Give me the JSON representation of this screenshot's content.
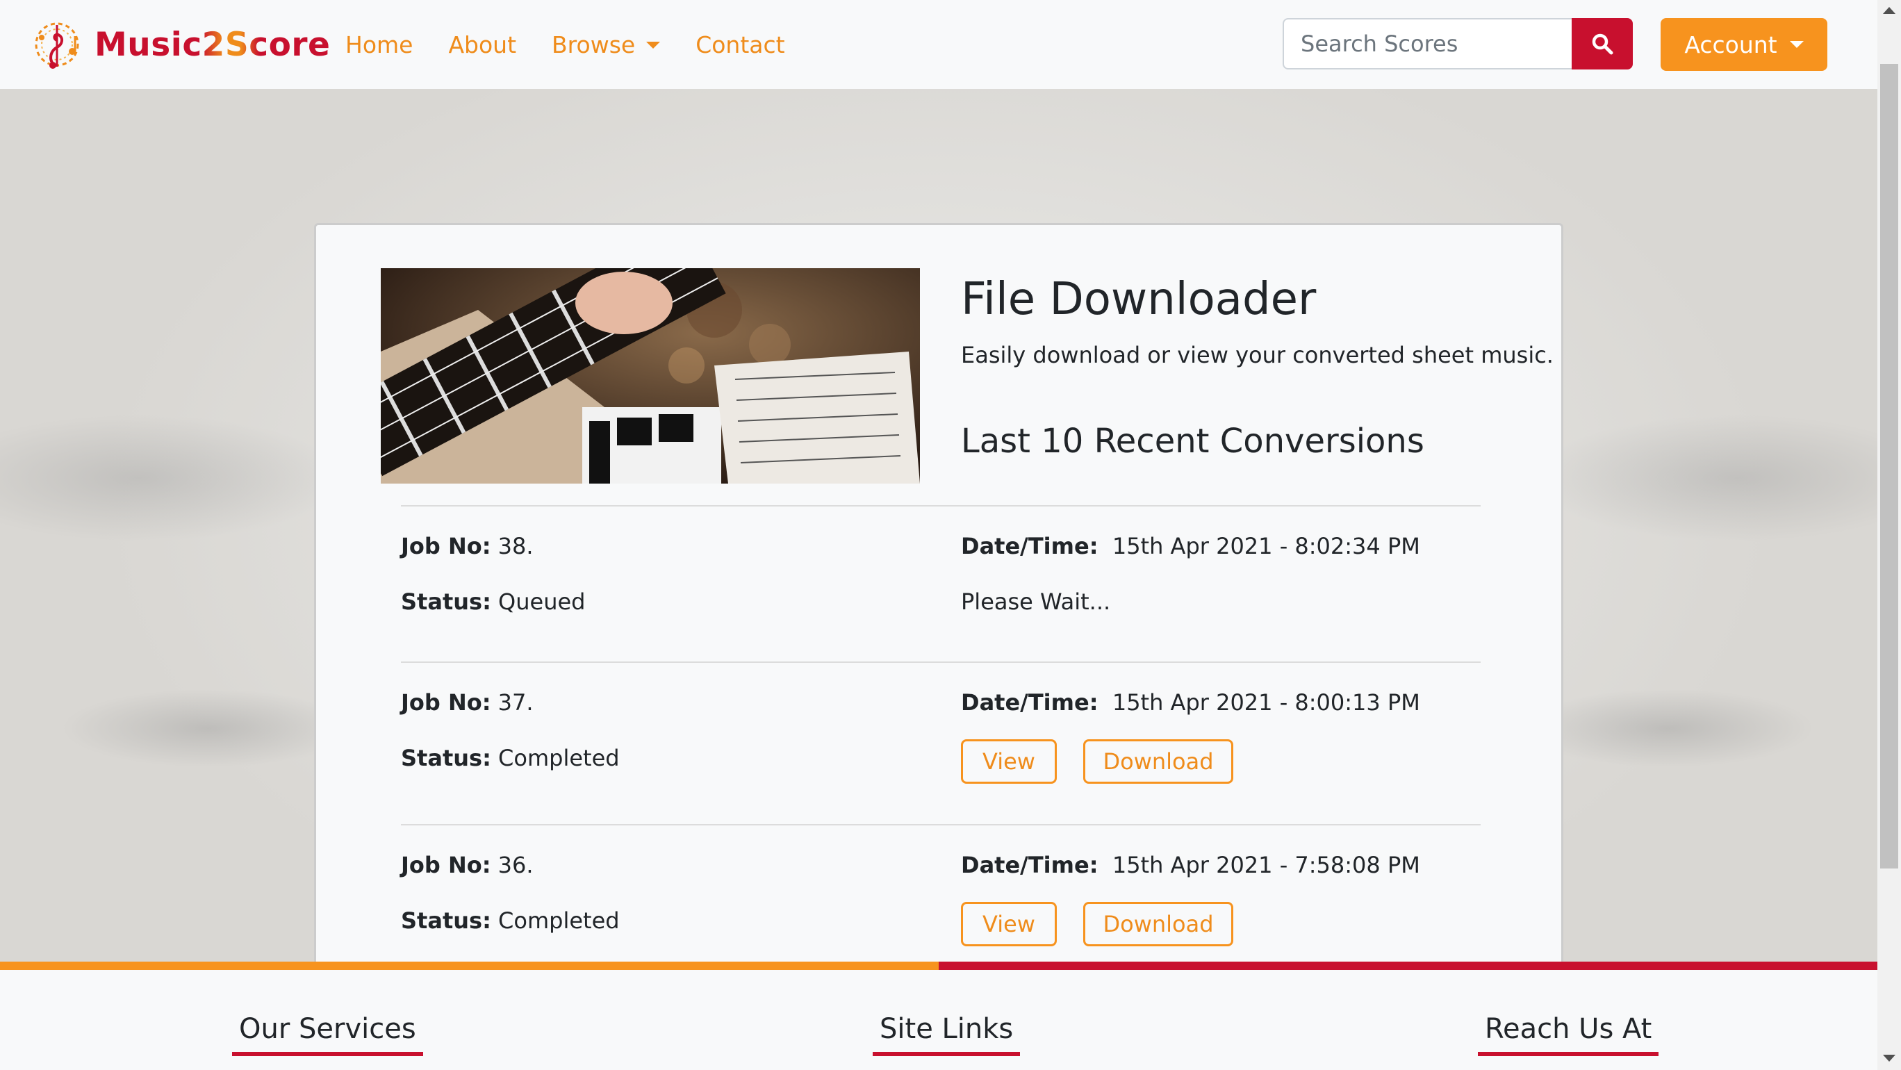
{
  "brand": {
    "name": "Music2Score"
  },
  "nav": {
    "links": [
      {
        "label": "Home"
      },
      {
        "label": "About"
      },
      {
        "label": "Browse"
      },
      {
        "label": "Contact"
      }
    ]
  },
  "search": {
    "placeholder": "Search Scores"
  },
  "account": {
    "label": "Account"
  },
  "page": {
    "title": "File Downloader",
    "subtitle": "Easily download or view your converted sheet music.",
    "section_title": "Last 10 Recent Conversions"
  },
  "labels": {
    "job_no": "Job No:",
    "status": "Status:",
    "datetime": "Date/Time:"
  },
  "jobs": [
    {
      "job_no": "38.",
      "status": "Queued",
      "datetime": "15th Apr 2021 - 8:02:34 PM",
      "note": "Please Wait..."
    },
    {
      "job_no": "37.",
      "status": "Completed",
      "datetime": "15th Apr 2021 - 8:00:13 PM",
      "view_label": "View",
      "download_label": "Download"
    },
    {
      "job_no": "36.",
      "status": "Completed",
      "datetime": "15th Apr 2021 - 7:58:08 PM",
      "view_label": "View",
      "download_label": "Download"
    }
  ],
  "footer": {
    "headings": [
      "Our Services",
      "Site Links",
      "Reach Us At"
    ]
  },
  "colors": {
    "orange": "#f7931e",
    "red": "#c8102e"
  }
}
